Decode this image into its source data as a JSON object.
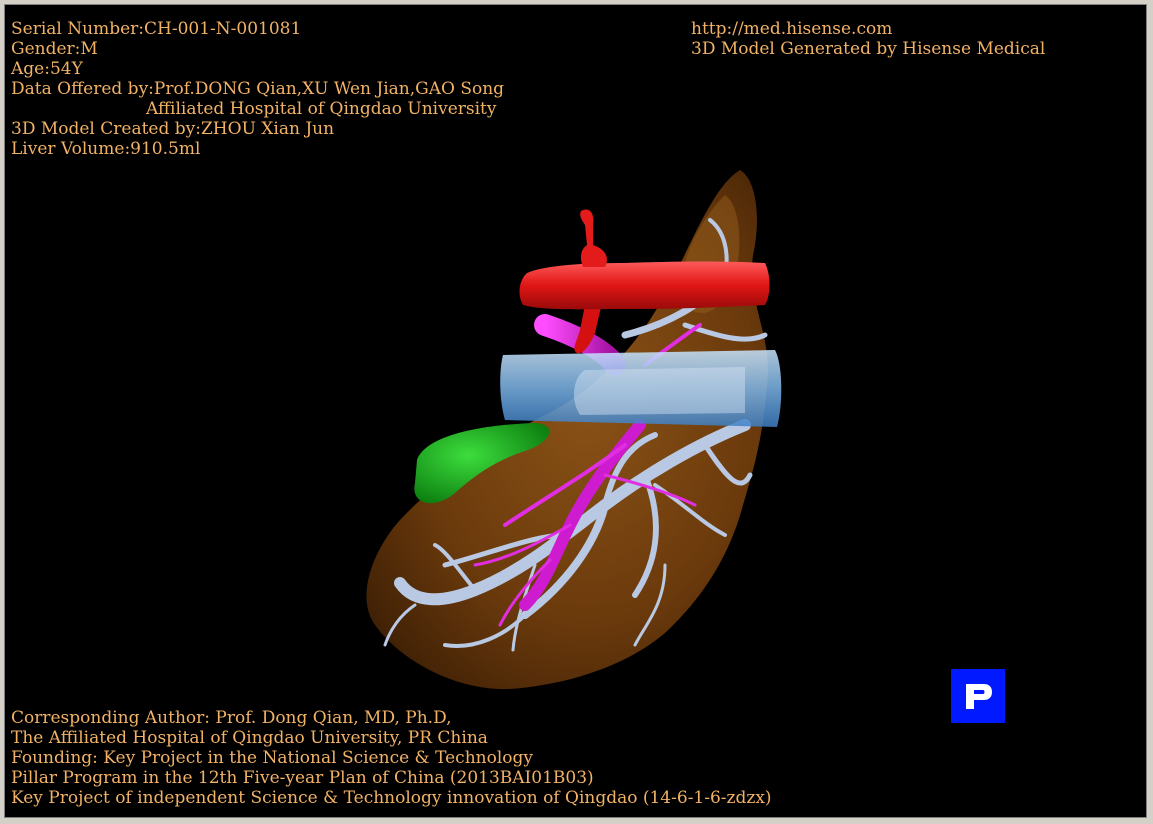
{
  "info_top_left": {
    "serial": "Serial Number:CH-001-N-001081",
    "gender": "Gender:M",
    "age": "Age:54Y",
    "data_offered": "Data Offered by:Prof.DONG Qian,XU Wen Jian,GAO Song",
    "hospital": "Affiliated Hospital of Qingdao University",
    "model_created": "3D Model Created by:ZHOU Xian Jun",
    "liver_volume": "Liver Volume:910.5ml"
  },
  "info_top_right": {
    "url": "http://med.hisense.com",
    "generator": "3D Model Generated by Hisense Medical"
  },
  "info_bottom_left": {
    "author": "Corresponding Author: Prof. Dong Qian, MD, Ph.D,",
    "affiliation": "The Affiliated Hospital of Qingdao University, PR China",
    "founding": "Founding: Key Project in the National Science & Technology",
    "pillar": "Pillar Program in the 12th Five-year Plan of China (2013BAI01B03)",
    "key_project": "Key Project of independent Science & Technology innovation of Qingdao (14-6-1-6-zdzx)"
  },
  "view_button": {
    "icon": "p-icon",
    "color": "#0019ff"
  },
  "colors": {
    "text": "#f2b266",
    "background": "#000000",
    "liver": "#7a4310",
    "artery": "#e31b1b",
    "vena_cava": "#8fc6f0",
    "portal_vein": "#d21ad2",
    "hepatic_veins": "#b9c8e3",
    "gallbladder": "#15b51a"
  }
}
